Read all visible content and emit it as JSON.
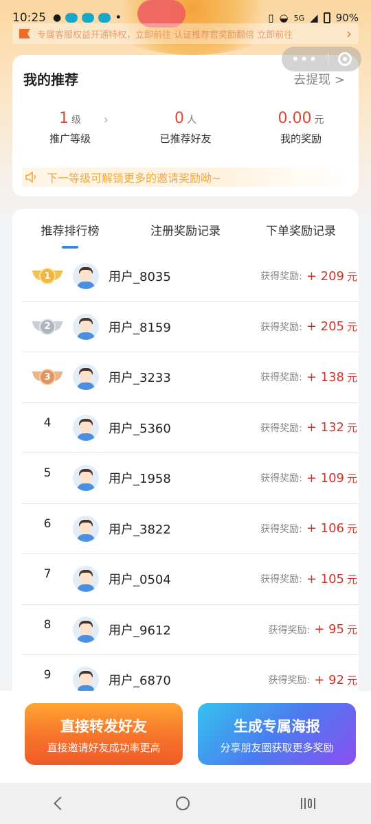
{
  "statusbar": {
    "time": "10:25",
    "network": "5G",
    "battery": "90%"
  },
  "notice": {
    "text": "专属客服权益开通特权，立即前往 认证推荐官奖励翻倍 立即前往"
  },
  "referral": {
    "title": "我的推荐",
    "withdraw": "去提现 >",
    "stats": [
      {
        "value": "1",
        "unit": "级",
        "label": "推广等级"
      },
      {
        "value": "0",
        "unit": "人",
        "label": "已推荐好友"
      },
      {
        "value": "0.00",
        "unit": "元",
        "label": "我的奖励"
      }
    ],
    "tip": "下一等级可解锁更多的邀请奖励呦~"
  },
  "tabs": [
    "推荐排行榜",
    "注册奖励记录",
    "下单奖励记录"
  ],
  "leaderboard": {
    "reward_label": "获得奖励:",
    "currency": "元",
    "rows": [
      {
        "rank": "1",
        "name": "用户_8035",
        "reward": "+ 209"
      },
      {
        "rank": "2",
        "name": "用户_8159",
        "reward": "+ 205"
      },
      {
        "rank": "3",
        "name": "用户_3233",
        "reward": "+ 138"
      },
      {
        "rank": "4",
        "name": "用户_5360",
        "reward": "+ 132"
      },
      {
        "rank": "5",
        "name": "用户_1958",
        "reward": "+ 109"
      },
      {
        "rank": "6",
        "name": "用户_3822",
        "reward": "+ 106"
      },
      {
        "rank": "7",
        "name": "用户_0504",
        "reward": "+ 105"
      },
      {
        "rank": "8",
        "name": "用户_9612",
        "reward": "+ 95"
      },
      {
        "rank": "9",
        "name": "用户_6870",
        "reward": "+ 92"
      }
    ]
  },
  "actions": {
    "share": {
      "title": "直接转发好友",
      "subtitle": "直接邀请好友成功率更高"
    },
    "poster": {
      "title": "生成专属海报",
      "subtitle": "分享朋友圈获取更多奖励"
    }
  },
  "colors": {
    "accent_red": "#c8372c",
    "tab_indicator": "#3a86e0",
    "tip_text": "#f0a838"
  }
}
